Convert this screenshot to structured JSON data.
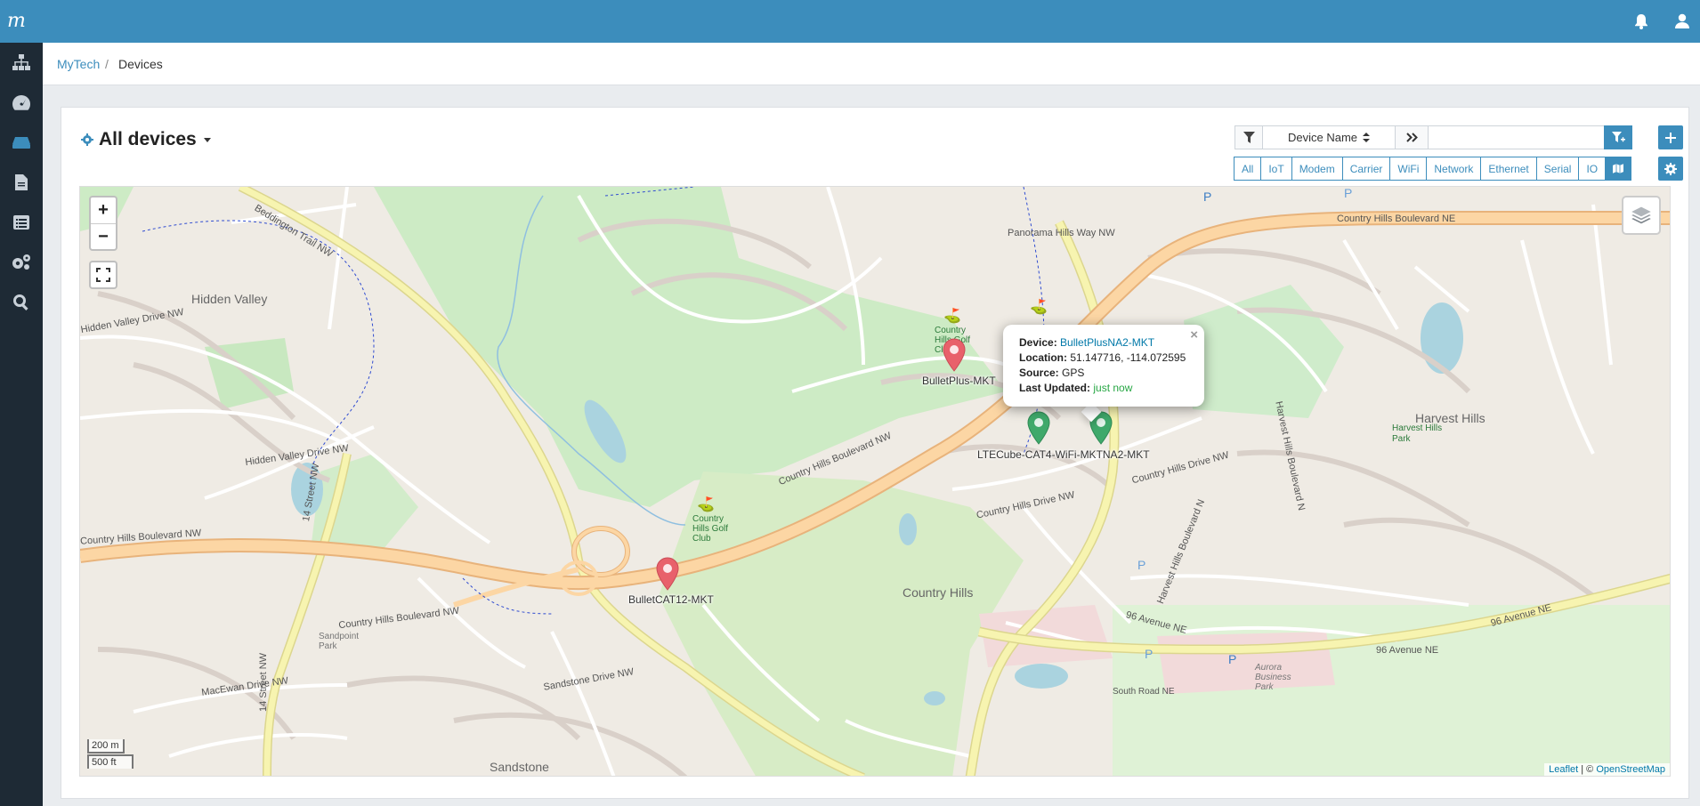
{
  "header": {
    "logo_text": "m"
  },
  "sidebar": {
    "items": [
      {
        "name": "topology-icon"
      },
      {
        "name": "dashboard-icon"
      },
      {
        "name": "devices-icon"
      },
      {
        "name": "reports-icon"
      },
      {
        "name": "list-icon"
      },
      {
        "name": "settings-icon"
      },
      {
        "name": "search-icon"
      }
    ]
  },
  "breadcrumb": {
    "parent": "MyTech",
    "separator": "/",
    "current": "Devices"
  },
  "page": {
    "title": "All devices"
  },
  "filter": {
    "field": "Device Name",
    "query": ""
  },
  "type_filters": [
    "All",
    "IoT",
    "Modem",
    "Carrier",
    "WiFi",
    "Network",
    "Ethernet",
    "Serial",
    "IO"
  ],
  "map": {
    "zoom_in": "+",
    "zoom_out": "−",
    "scale_metric": "200 m",
    "scale_imperial": "500 ft",
    "attribution_leaflet": "Leaflet",
    "attribution_sep": " | © ",
    "attribution_osm": "OpenStreetMap",
    "labels": {
      "hidden_valley": "Hidden Valley",
      "country_hills": "Country Hills",
      "harvest_hills": "Harvest Hills",
      "sandstone": "Sandstone",
      "harvest_hills_park": "Harvest Hills Park",
      "country_hills_golf": "Country Hills Golf Club",
      "country_hills_golf_2": "Country Hills Golf Club",
      "beddington_trail": "Beddington Trail NW",
      "country_hills_blvd_nw": "Country Hills Boulevard NW",
      "country_hills_blvd_nw2": "Country Hills Boulevard NW",
      "country_hills_blvd_ne": "Country Hills Boulevard NE",
      "harvest_hills_blvd": "Harvest Hills Boulevard N",
      "ave96_ne": "96 Avenue NE",
      "ave96_ne2": "96 Avenue NE",
      "street14": "14 Street NW",
      "hidden_valley_drive": "Hidden Valley Drive NW",
      "panorama_hills_way": "Panorama Hills Way NW",
      "country_hills_drive": "Country Hills Drive NW",
      "sandpoint_park": "Sandpoint Park",
      "aurora_business_park": "Aurora Business Park",
      "south_road": "South Road NE",
      "macewan_drive": "MacEwan Drive NW",
      "sandstone_drive": "Sandstone Drive NW"
    },
    "markers": [
      {
        "name": "BulletPlus-MKT",
        "status": "offline"
      },
      {
        "name": "LTECube-CAT4-WiFi-MKT",
        "status": "online"
      },
      {
        "name": "BulletPlusNA2-MKT",
        "status": "online"
      },
      {
        "name": "BulletCAT12-MKT",
        "status": "offline"
      }
    ],
    "popup": {
      "device_label": "Device:",
      "device_value": "BulletPlusNA2-MKT",
      "location_label": "Location:",
      "location_value": "51.147716, -114.072595",
      "source_label": "Source:",
      "source_value": "GPS",
      "updated_label": "Last Updated:",
      "updated_value": "just now",
      "close": "×"
    },
    "overlap_label": "LTECube-CAT4-WiFi-MKTNA2-MKT"
  },
  "colors": {
    "primary": "#3c8dbc",
    "marker_offline": "#e8616b",
    "marker_online": "#3fa96b"
  }
}
